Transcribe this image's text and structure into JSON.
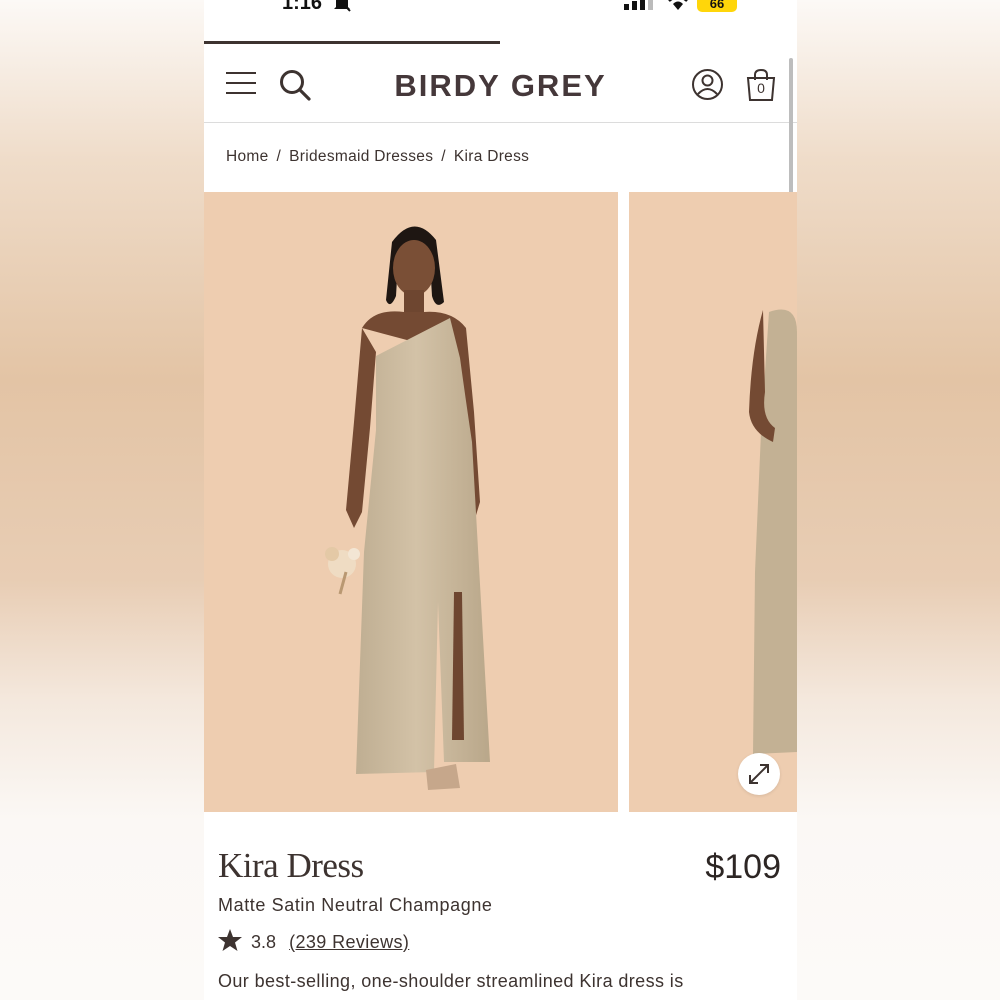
{
  "status_bar": {
    "time": "1:16",
    "battery": "66",
    "icons": [
      "bell-slash-icon",
      "cellular-signal-icon",
      "wifi-icon",
      "battery-icon"
    ]
  },
  "header": {
    "brand": "BIRDY GREY",
    "bag_count": "0",
    "icons": [
      "menu-icon",
      "search-icon",
      "account-icon",
      "shopping-bag-icon"
    ]
  },
  "breadcrumb": {
    "items": [
      "Home",
      "Bridesmaid Dresses",
      "Kira Dress"
    ],
    "separator": "/"
  },
  "gallery": {
    "expand_icon": "expand-icon"
  },
  "product": {
    "name": "Kira Dress",
    "price": "$109",
    "color": "Matte Satin Neutral Champagne",
    "rating": "3.8",
    "reviews": "(239 Reviews)",
    "description": "Our best-selling, one-shoulder streamlined Kira dress is"
  },
  "colors": {
    "text": "#3d3330",
    "image_background": "#eecdb0",
    "dress": "#cbb89b",
    "battery": "#ffd60a"
  }
}
